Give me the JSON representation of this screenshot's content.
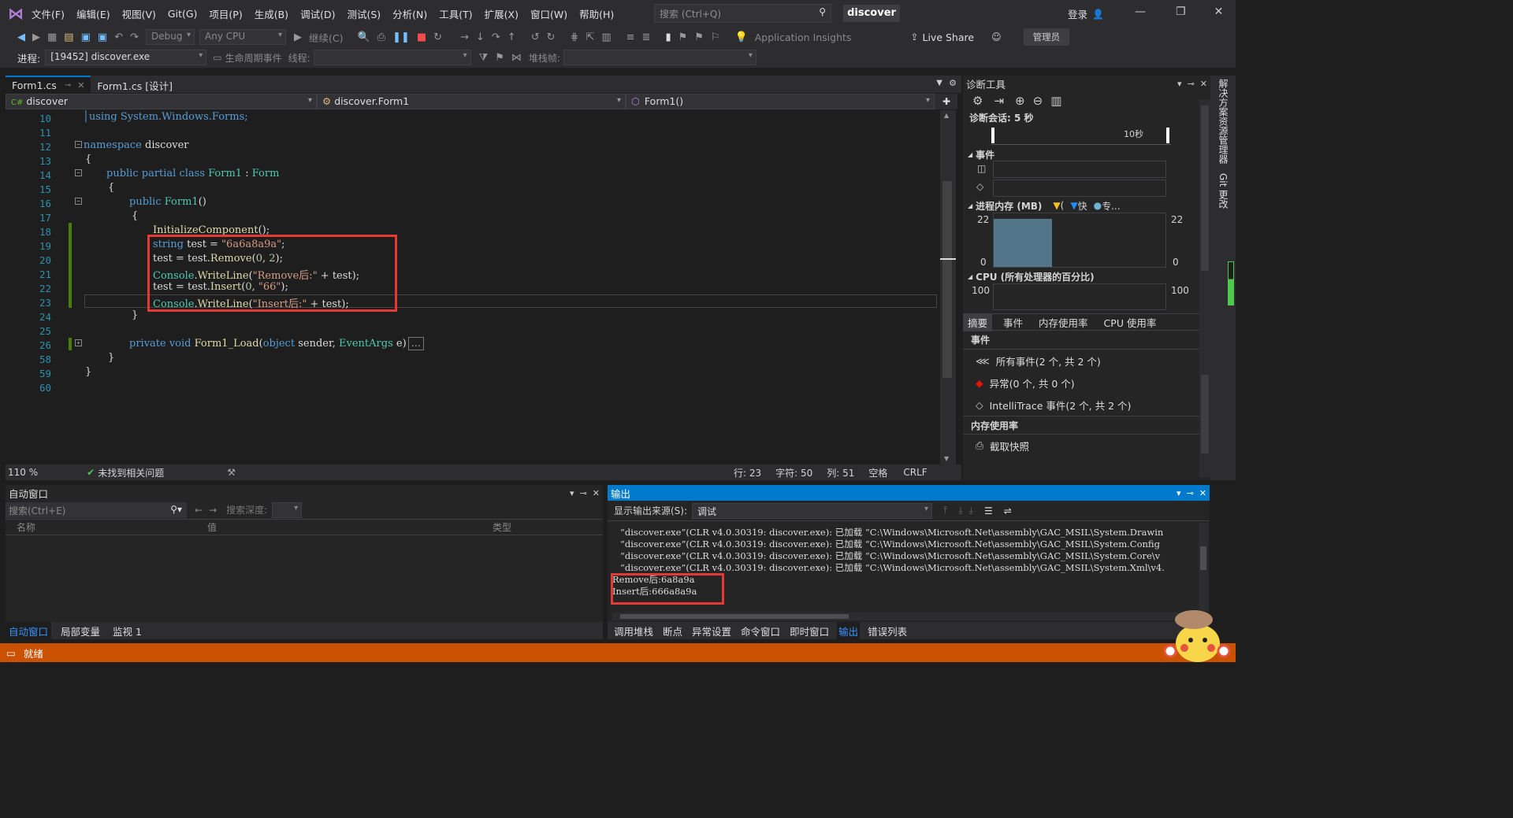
{
  "menu": [
    "文件(F)",
    "编辑(E)",
    "视图(V)",
    "Git(G)",
    "项目(P)",
    "生成(B)",
    "调试(D)",
    "测试(S)",
    "分析(N)",
    "工具(T)",
    "扩展(X)",
    "窗口(W)",
    "帮助(H)"
  ],
  "search": {
    "placeholder": "搜索 (Ctrl+Q)"
  },
  "app_name": "discover",
  "login": "登录",
  "toolbar": {
    "config": "Debug",
    "platform": "Any CPU",
    "continue": "继续(C)",
    "app_insights": "Application Insights",
    "live_share": "Live Share",
    "admin": "管理员"
  },
  "toolbar2": {
    "process_label": "进程:",
    "process_value": "[19452] discover.exe",
    "lifecycle": "生命周期事件",
    "thread_label": "线程:",
    "stack_label": "堆栈帧:"
  },
  "tabs": [
    {
      "label": "Form1.cs"
    },
    {
      "label": "Form1.cs [设计]"
    }
  ],
  "navbar": {
    "project": "discover",
    "class": "discover.Form1",
    "member": "Form1()"
  },
  "code": {
    "line_numbers": [
      "10",
      "11",
      "12",
      "13",
      "14",
      "15",
      "16",
      "17",
      "18",
      "19",
      "20",
      "21",
      "22",
      "23",
      "24",
      "25",
      "26",
      "58",
      "59",
      "60"
    ],
    "l10": "using System.Windows.Forms;",
    "l12a": "namespace",
    "l12b": " discover",
    "l13": "{",
    "l14a": "public partial class ",
    "l14b": "Form1",
    "l14c": " : ",
    "l14d": "Form",
    "l15": "{",
    "l16a": "public ",
    "l16b": "Form1",
    "l16c": "()",
    "l17": "{",
    "l18a": "InitializeComponent",
    "l18b": "();",
    "l19a": "string",
    "l19b": " test = ",
    "l19c": "\"6a6a8a9a\"",
    "l19d": ";",
    "l20a": "test = test.",
    "l20b": "Remove",
    "l20c": "(",
    "l20d": "0",
    "l20e": ", ",
    "l20f": "2",
    "l20g": ");",
    "l21a": "Console",
    "l21b": ".",
    "l21c": "WriteLine",
    "l21d": "(",
    "l21e": "\"Remove后:\"",
    "l21f": " + test);",
    "l22a": "test = test.",
    "l22b": "Insert",
    "l22c": "(",
    "l22d": "0",
    "l22e": ", ",
    "l22f": "\"66\"",
    "l22g": ");",
    "l23a": "Console",
    "l23b": ".",
    "l23c": "WriteLine",
    "l23d": "(",
    "l23e": "\"Insert后:\"",
    "l23f": " + test);",
    "l24": "}",
    "l26a": "private void ",
    "l26b": "Form1_Load",
    "l26c": "(",
    "l26d": "object",
    "l26e": " sender, ",
    "l26f": "EventArgs",
    "l26g": " e)",
    "l26h": "...",
    "l58": "}",
    "l59": "}"
  },
  "editor_status": {
    "zoom": "110 %",
    "issues": "未找到相关问题",
    "line": "行: 23",
    "char": "字符: 50",
    "col": "列: 51",
    "space": "空格",
    "eol": "CRLF"
  },
  "diag": {
    "title": "诊断工具",
    "session": "诊断会话: 5 秒",
    "timeline_label": "10秒",
    "events_label": "事件",
    "memory_label": "进程内存 (MB)",
    "memory_legend": [
      "(",
      "快",
      "专..."
    ],
    "mem_max": "22",
    "mem_min": "0",
    "cpu_label": "CPU (所有处理器的百分比)",
    "cpu_max": "100",
    "tabs": [
      "摘要",
      "事件",
      "内存使用率",
      "CPU 使用率"
    ],
    "section_events": "事件",
    "all_events": "所有事件(2 个, 共 2 个)",
    "exceptions": "异常(0 个, 共 0 个)",
    "intellitrace": "IntelliTrace 事件(2 个, 共 2 个)",
    "section_memory": "内存使用率",
    "snapshot": "截取快照"
  },
  "right_strip": {
    "solution": "解决方案资源管理器",
    "git": "Git 更改"
  },
  "autowin": {
    "title": "自动窗口",
    "search": "搜索(Ctrl+E)",
    "depth": "搜索深度:",
    "col_name": "名称",
    "col_value": "值",
    "col_type": "类型",
    "tabs": [
      "自动窗口",
      "局部变量",
      "监视 1"
    ]
  },
  "output": {
    "title": "输出",
    "source_label": "显示输出来源(S):",
    "source_value": "调试",
    "lines": [
      "“discover.exe”(CLR v4.0.30319: discover.exe): 已加载 “C:\\Windows\\Microsoft.Net\\assembly\\GAC_MSIL\\System.Drawin",
      "“discover.exe”(CLR v4.0.30319: discover.exe): 已加载 “C:\\Windows\\Microsoft.Net\\assembly\\GAC_MSIL\\System.Config",
      "“discover.exe”(CLR v4.0.30319: discover.exe): 已加载 “C:\\Windows\\Microsoft.Net\\assembly\\GAC_MSIL\\System.Core\\v",
      "“discover.exe”(CLR v4.0.30319: discover.exe): 已加载 “C:\\Windows\\Microsoft.Net\\assembly\\GAC_MSIL\\System.Xml\\v4.",
      "Remove后:6a8a9a",
      "Insert后:666a8a9a"
    ],
    "tabs": [
      "调用堆栈",
      "断点",
      "异常设置",
      "命令窗口",
      "即时窗口",
      "输出",
      "错误列表"
    ]
  },
  "status": "就绪",
  "accent": "#007acc",
  "status_color": "#ca5100"
}
